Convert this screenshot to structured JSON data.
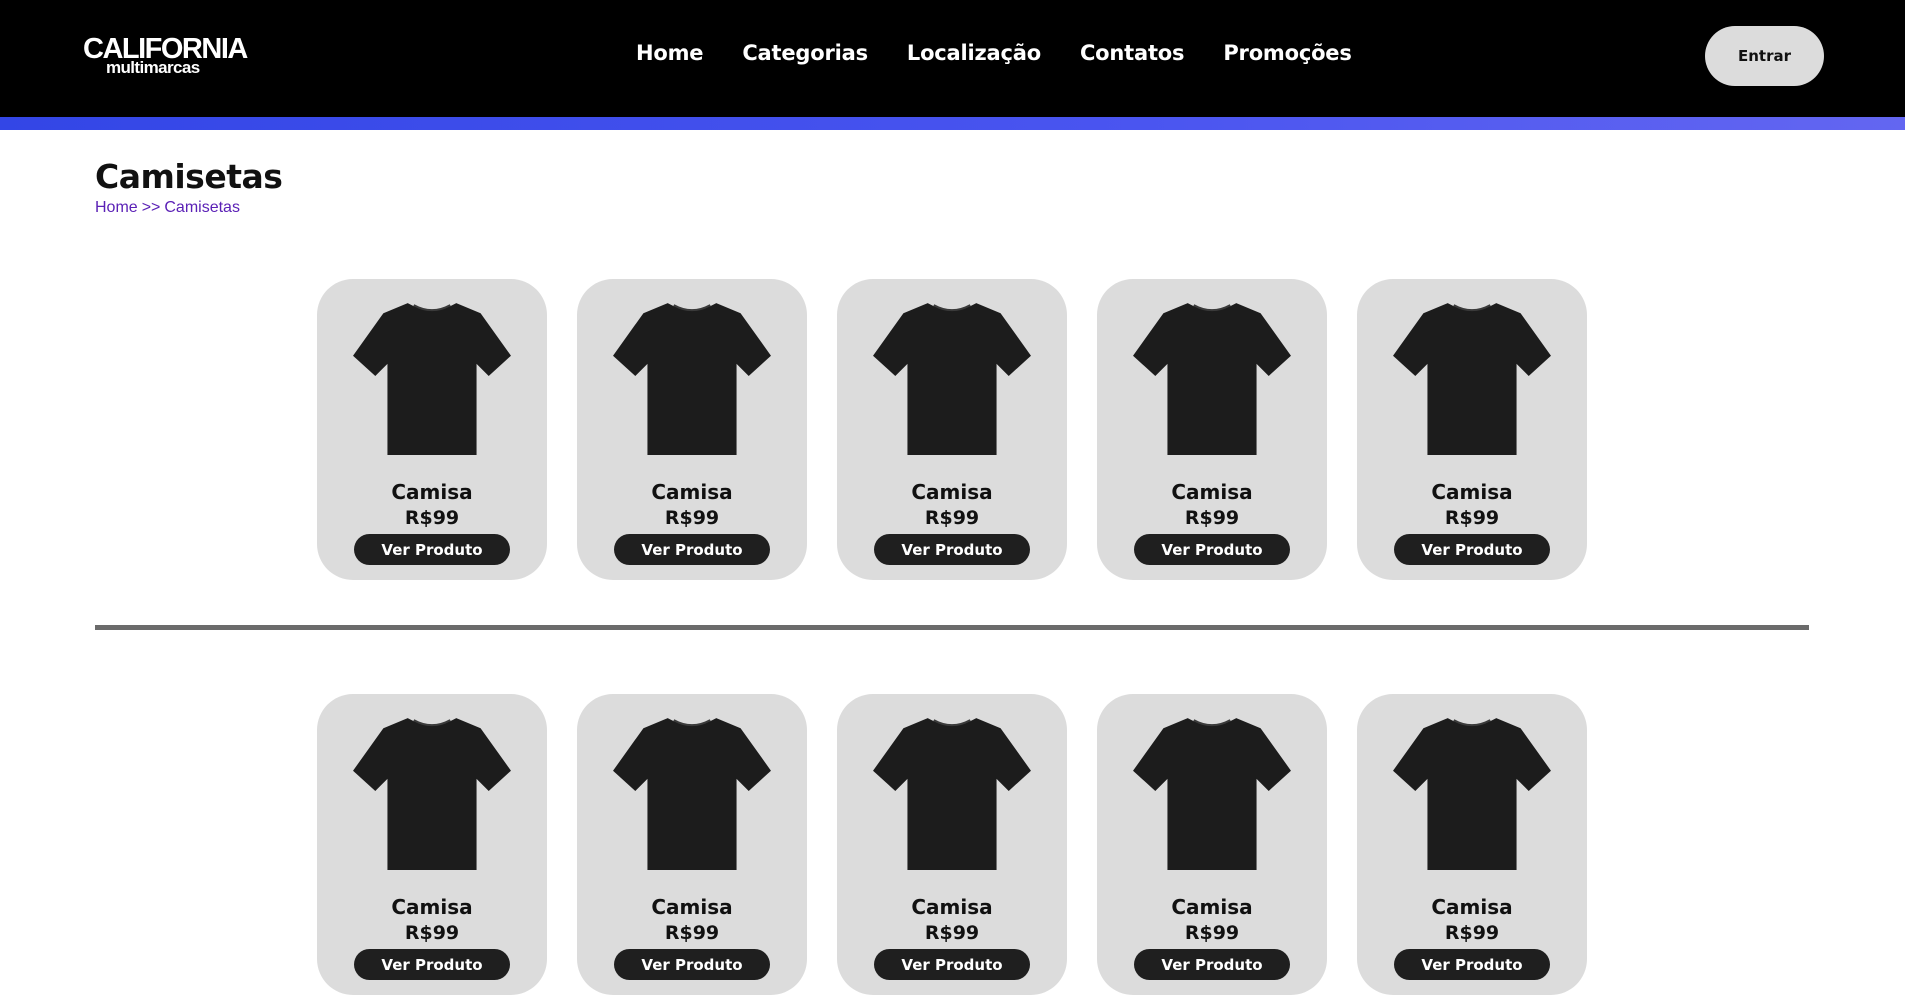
{
  "brand": {
    "logo_main": "CALIFORNIA",
    "logo_sub": "multimarcas"
  },
  "nav": {
    "items": [
      {
        "label": "Home"
      },
      {
        "label": "Categorias"
      },
      {
        "label": "Localização"
      },
      {
        "label": "Contatos"
      },
      {
        "label": "Promoções"
      }
    ]
  },
  "header": {
    "login_label": "Entrar"
  },
  "colors": {
    "header_bg": "#000000",
    "accent": "#4a55f0",
    "card_bg": "#dcdcdc",
    "button_bg": "#1f1f1f",
    "link": "#5b21b6"
  },
  "page": {
    "title": "Camisetas",
    "breadcrumb": {
      "home": "Home",
      "separator": ">>",
      "current": "Camisetas"
    }
  },
  "products_row1": [
    {
      "name": "Camisa",
      "price": "R$99",
      "button": "Ver Produto",
      "icon": "tshirt-icon"
    },
    {
      "name": "Camisa",
      "price": "R$99",
      "button": "Ver Produto",
      "icon": "tshirt-icon"
    },
    {
      "name": "Camisa",
      "price": "R$99",
      "button": "Ver Produto",
      "icon": "tshirt-icon"
    },
    {
      "name": "Camisa",
      "price": "R$99",
      "button": "Ver Produto",
      "icon": "tshirt-icon"
    },
    {
      "name": "Camisa",
      "price": "R$99",
      "button": "Ver Produto",
      "icon": "tshirt-icon"
    }
  ],
  "products_row2": [
    {
      "name": "Camisa",
      "price": "R$99",
      "button": "Ver Produto",
      "icon": "tshirt-icon"
    },
    {
      "name": "Camisa",
      "price": "R$99",
      "button": "Ver Produto",
      "icon": "tshirt-icon"
    },
    {
      "name": "Camisa",
      "price": "R$99",
      "button": "Ver Produto",
      "icon": "tshirt-icon"
    },
    {
      "name": "Camisa",
      "price": "R$99",
      "button": "Ver Produto",
      "icon": "tshirt-icon"
    },
    {
      "name": "Camisa",
      "price": "R$99",
      "button": "Ver Produto",
      "icon": "tshirt-icon"
    }
  ]
}
